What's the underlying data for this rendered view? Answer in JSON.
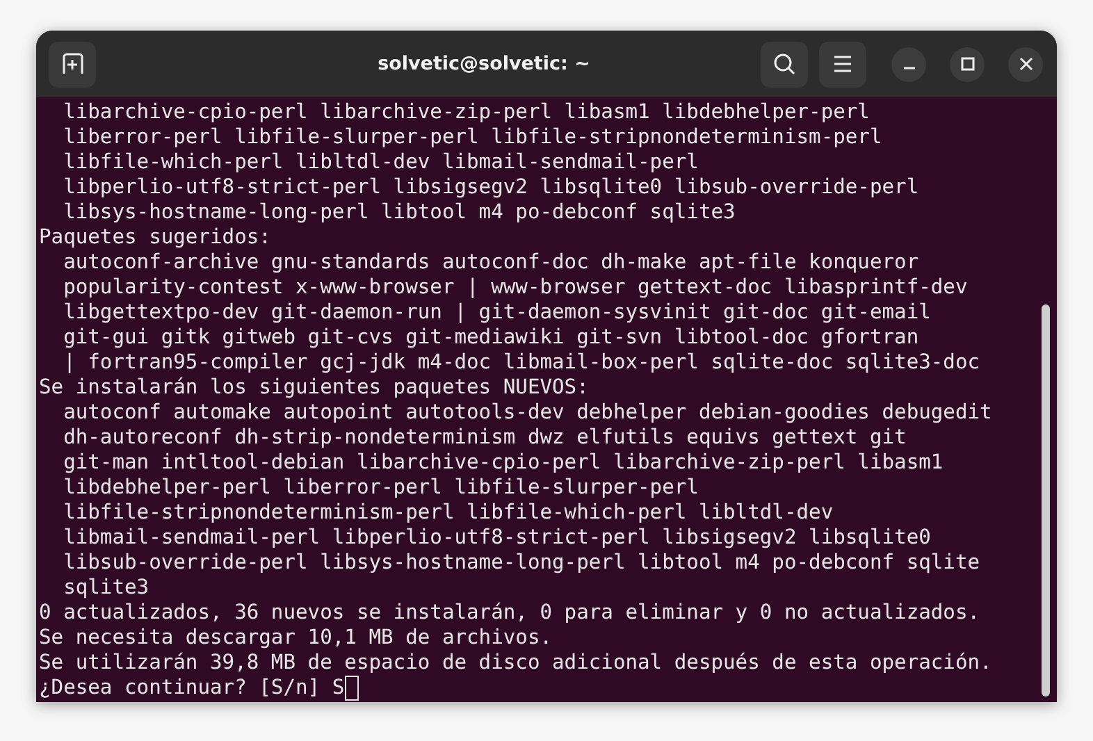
{
  "window": {
    "title": "solvetic@solvetic: ~"
  },
  "terminal": {
    "lines": [
      "  libarchive-cpio-perl libarchive-zip-perl libasm1 libdebhelper-perl",
      "  liberror-perl libfile-slurper-perl libfile-stripnondeterminism-perl",
      "  libfile-which-perl libltdl-dev libmail-sendmail-perl",
      "  libperlio-utf8-strict-perl libsigsegv2 libsqlite0 libsub-override-perl",
      "  libsys-hostname-long-perl libtool m4 po-debconf sqlite3",
      "Paquetes sugeridos:",
      "  autoconf-archive gnu-standards autoconf-doc dh-make apt-file konqueror",
      "  popularity-contest x-www-browser | www-browser gettext-doc libasprintf-dev",
      "  libgettextpo-dev git-daemon-run | git-daemon-sysvinit git-doc git-email",
      "  git-gui gitk gitweb git-cvs git-mediawiki git-svn libtool-doc gfortran",
      "  | fortran95-compiler gcj-jdk m4-doc libmail-box-perl sqlite-doc sqlite3-doc",
      "Se instalarán los siguientes paquetes NUEVOS:",
      "  autoconf automake autopoint autotools-dev debhelper debian-goodies debugedit",
      "  dh-autoreconf dh-strip-nondeterminism dwz elfutils equivs gettext git",
      "  git-man intltool-debian libarchive-cpio-perl libarchive-zip-perl libasm1",
      "  libdebhelper-perl liberror-perl libfile-slurper-perl",
      "  libfile-stripnondeterminism-perl libfile-which-perl libltdl-dev",
      "  libmail-sendmail-perl libperlio-utf8-strict-perl libsigsegv2 libsqlite0",
      "  libsub-override-perl libsys-hostname-long-perl libtool m4 po-debconf sqlite",
      "  sqlite3",
      "0 actualizados, 36 nuevos se instalarán, 0 para eliminar y 0 no actualizados.",
      "Se necesita descargar 10,1 MB de archivos.",
      "Se utilizarán 39,8 MB de espacio de disco adicional después de esta operación."
    ],
    "prompt": {
      "text": "¿Desea continuar? [S/n] S",
      "cursor": true
    }
  }
}
